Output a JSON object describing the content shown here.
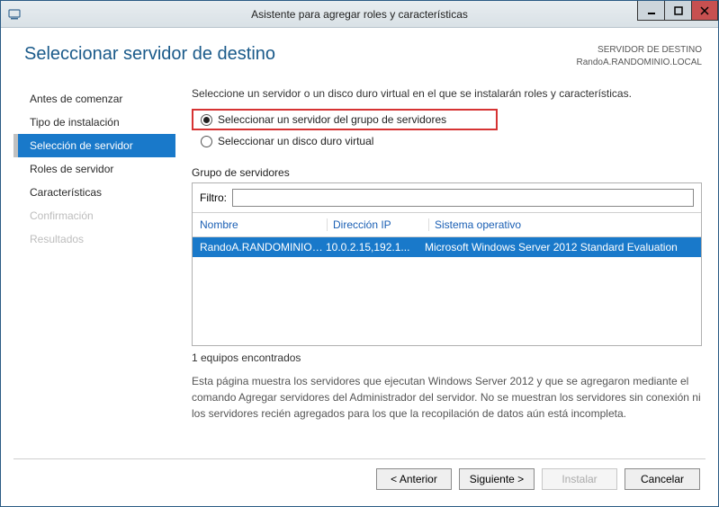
{
  "window": {
    "title": "Asistente para agregar roles y características"
  },
  "header": {
    "page_title": "Seleccionar servidor de destino",
    "dest_label": "SERVIDOR DE DESTINO",
    "dest_value": "RandoA.RANDOMINIO.LOCAL"
  },
  "sidebar": {
    "items": [
      {
        "label": "Antes de comenzar",
        "state": "normal"
      },
      {
        "label": "Tipo de instalación",
        "state": "normal"
      },
      {
        "label": "Selección de servidor",
        "state": "active"
      },
      {
        "label": "Roles de servidor",
        "state": "normal"
      },
      {
        "label": "Características",
        "state": "normal"
      },
      {
        "label": "Confirmación",
        "state": "disabled"
      },
      {
        "label": "Resultados",
        "state": "disabled"
      }
    ]
  },
  "main": {
    "instruction": "Seleccione un servidor o un disco duro virtual en el que se instalarán roles y características.",
    "radio": {
      "option_pool": "Seleccionar un servidor del grupo de servidores",
      "option_vhd": "Seleccionar un disco duro virtual"
    },
    "group_label": "Grupo de servidores",
    "filter_label": "Filtro:",
    "filter_value": "",
    "columns": {
      "name": "Nombre",
      "ip": "Dirección IP",
      "os": "Sistema operativo"
    },
    "rows": [
      {
        "name": "RandoA.RANDOMINIO.L...",
        "ip": "10.0.2.15,192.1...",
        "os": "Microsoft Windows Server 2012 Standard Evaluation"
      }
    ],
    "found_text": "1 equipos encontrados",
    "help_text": "Esta página muestra los servidores que ejecutan Windows Server 2012 y que se agregaron mediante el comando Agregar servidores del Administrador del servidor. No se muestran los servidores sin conexión ni los servidores recién agregados para los que la recopilación de datos aún está incompleta."
  },
  "buttons": {
    "previous": "< Anterior",
    "next": "Siguiente >",
    "install": "Instalar",
    "cancel": "Cancelar"
  }
}
